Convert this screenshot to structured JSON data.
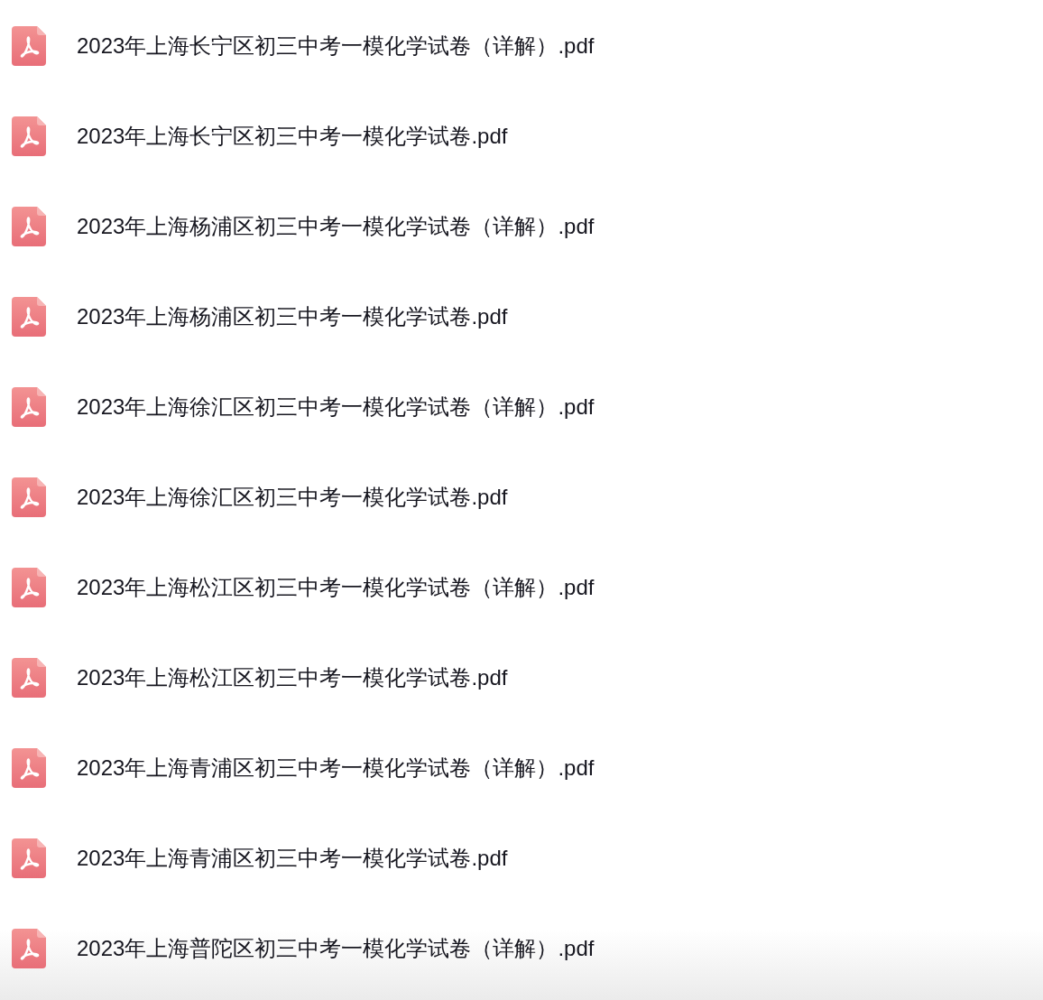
{
  "files": [
    {
      "name": "2023年上海长宁区初三中考一模化学试卷（详解）.pdf"
    },
    {
      "name": "2023年上海长宁区初三中考一模化学试卷.pdf"
    },
    {
      "name": "2023年上海杨浦区初三中考一模化学试卷（详解）.pdf"
    },
    {
      "name": "2023年上海杨浦区初三中考一模化学试卷.pdf"
    },
    {
      "name": "2023年上海徐汇区初三中考一模化学试卷（详解）.pdf"
    },
    {
      "name": "2023年上海徐汇区初三中考一模化学试卷.pdf"
    },
    {
      "name": "2023年上海松江区初三中考一模化学试卷（详解）.pdf"
    },
    {
      "name": "2023年上海松江区初三中考一模化学试卷.pdf"
    },
    {
      "name": "2023年上海青浦区初三中考一模化学试卷（详解）.pdf"
    },
    {
      "name": "2023年上海青浦区初三中考一模化学试卷.pdf"
    },
    {
      "name": "2023年上海普陀区初三中考一模化学试卷（详解）.pdf"
    }
  ]
}
